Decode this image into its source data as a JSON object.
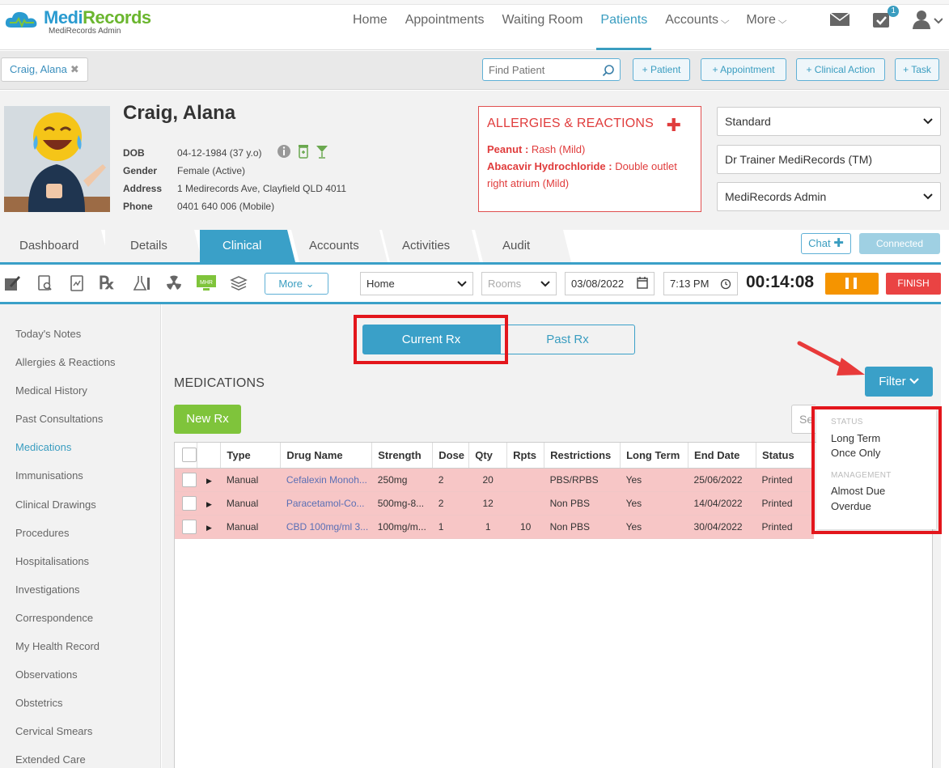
{
  "app": {
    "brand_part1": "Medi",
    "brand_part2": "Records",
    "brand_sub": "MediRecords Admin"
  },
  "nav": {
    "items": [
      {
        "label": "Home"
      },
      {
        "label": "Appointments"
      },
      {
        "label": "Waiting Room"
      },
      {
        "label": "Patients",
        "active": true
      },
      {
        "label": "Accounts",
        "dropdown": true
      },
      {
        "label": "More",
        "dropdown": true
      }
    ],
    "tasks_badge": "1"
  },
  "patientbar": {
    "tab_label": "Craig, Alana",
    "search_placeholder": "Find Patient",
    "buttons": [
      "+ Patient",
      "+ Appointment",
      "+ Clinical Action",
      "+ Task"
    ]
  },
  "patient": {
    "name": "Craig, Alana",
    "dob_label": "DOB",
    "dob": "04-12-1984 (37 y.o)",
    "gender_label": "Gender",
    "gender": "Female (Active)",
    "address_label": "Address",
    "address": "1 Medirecords Ave, Clayfield QLD 4011",
    "phone_label": "Phone",
    "phone": "0401 640 006 (Mobile)"
  },
  "allergies": {
    "title": "ALLERGIES & REACTIONS",
    "items": [
      {
        "name": "Peanut",
        "reaction": "Rash (Mild)"
      },
      {
        "name": "Abacavir Hydrochloride",
        "reaction": "Double outlet right atrium (Mild)"
      }
    ]
  },
  "selectors": {
    "plan": "Standard",
    "doctor": "Dr Trainer MediRecords (TM)",
    "org": "MediRecords Admin"
  },
  "tabs": [
    "Dashboard",
    "Details",
    "Clinical",
    "Accounts",
    "Activities",
    "Audit"
  ],
  "active_tab": "Clinical",
  "chat_label": "Chat",
  "connected_label": "Connected",
  "toolbar": {
    "more_label": "More",
    "location": "Home",
    "rooms_placeholder": "Rooms",
    "date": "03/08/2022",
    "time": "7:13 PM",
    "timer": "00:14:08",
    "finish_label": "FINISH",
    "mhr_label": "MHR"
  },
  "sidebar": [
    "Today's Notes",
    "Allergies & Reactions",
    "Medical History",
    "Past Consultations",
    "Medications",
    "Immunisations",
    "Clinical Drawings",
    "Procedures",
    "Hospitalisations",
    "Investigations",
    "Correspondence",
    "My Health Record",
    "Observations",
    "Obstetrics",
    "Cervical Smears",
    "Extended Care"
  ],
  "sidebar_active": "Medications",
  "rx": {
    "current_label": "Current Rx",
    "past_label": "Past Rx",
    "section_title": "MEDICATIONS",
    "new_rx_label": "New Rx",
    "filter_label": "Filter",
    "search_stub": "Se"
  },
  "table": {
    "headers": [
      "Type",
      "Drug Name",
      "Strength",
      "Dose",
      "Qty",
      "Rpts",
      "Restrictions",
      "Long Term",
      "End Date",
      "Status"
    ],
    "rows": [
      {
        "type": "Manual",
        "drug": "Cefalexin Monoh...",
        "strength": "250mg",
        "dose": "2",
        "qty": "20",
        "rpts": "",
        "restrictions": "PBS/RPBS",
        "longterm": "Yes",
        "end": "25/06/2022",
        "status": "Printed"
      },
      {
        "type": "Manual",
        "drug": "Paracetamol-Co...",
        "strength": "500mg-8...",
        "dose": "2",
        "qty": "12",
        "rpts": "",
        "restrictions": "Non PBS",
        "longterm": "Yes",
        "end": "14/04/2022",
        "status": "Printed"
      },
      {
        "type": "Manual",
        "drug": "CBD 100mg/ml 3...",
        "strength": "100mg/m...",
        "dose": "1",
        "qty": "1",
        "rpts": "10",
        "restrictions": "Non PBS",
        "longterm": "Yes",
        "end": "30/04/2022",
        "status": "Printed"
      }
    ]
  },
  "filter_menu": {
    "status_heading": "STATUS",
    "status_items": [
      "Long Term",
      "Once Only"
    ],
    "management_heading": "MANAGEMENT",
    "management_items": [
      "Almost Due",
      "Overdue"
    ]
  },
  "colors": {
    "accent": "#3aa0c8",
    "highlight_box": "#e3161c",
    "row_pink": "#f7c6c6",
    "new_rx": "#7fc43b",
    "pause": "#f59400",
    "finish": "#ea4343"
  }
}
